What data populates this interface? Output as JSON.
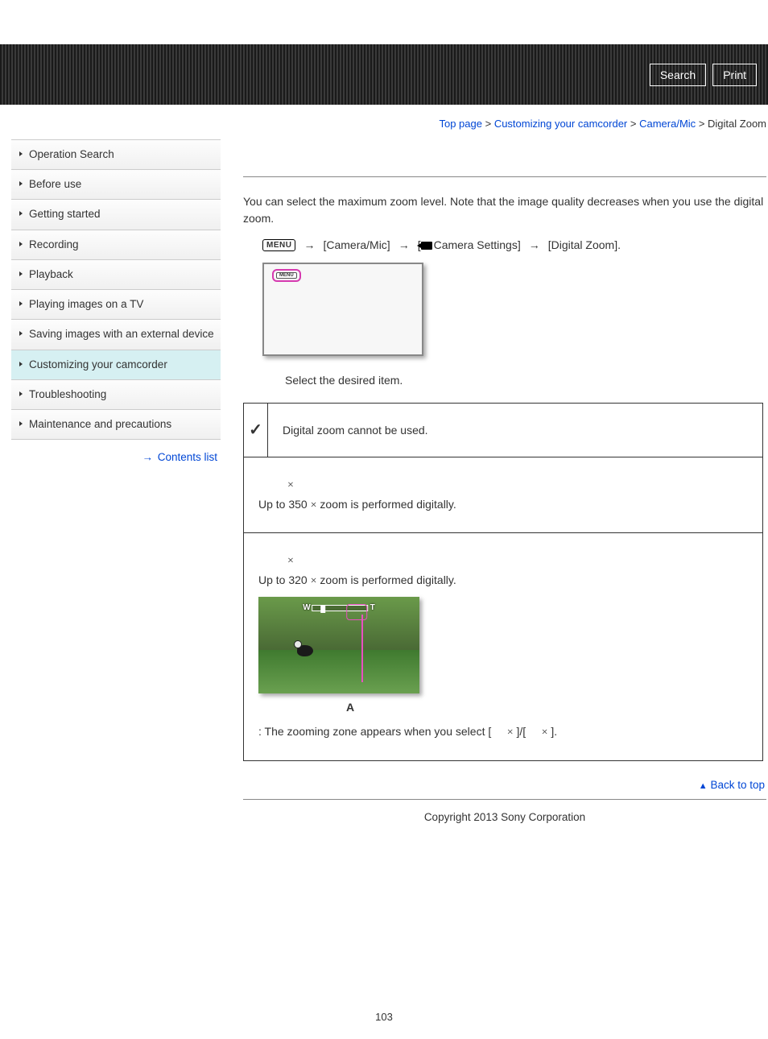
{
  "header": {
    "search": "Search",
    "print": "Print"
  },
  "breadcrumb": {
    "items": [
      "Top page",
      "Customizing your camcorder",
      "Camera/Mic",
      "Digital Zoom"
    ],
    "sep": ">"
  },
  "sidebar": {
    "items": [
      "Operation Search",
      "Before use",
      "Getting started",
      "Recording",
      "Playback",
      "Playing images on a TV",
      "Saving images with an external device",
      "Customizing your camcorder",
      "Troubleshooting",
      "Maintenance and precautions"
    ],
    "active_index": 7,
    "contents_link": "Contents list"
  },
  "content": {
    "intro": "You can select the maximum zoom level. Note that the image quality decreases when you use the digital zoom.",
    "menu_badge": "MENU",
    "path_seg1": "[Camera/Mic]",
    "path_seg2_pre": "[",
    "path_seg2_post": "Camera Settings]",
    "path_seg3": "[Digital Zoom].",
    "select_text": "Select the desired item.",
    "row1": "Digital zoom cannot be used.",
    "row2_l1_pre": "Up to 350 ",
    "row2_l1_post": " zoom is performed digitally.",
    "row3_l1_pre": "Up to 320 ",
    "row3_l1_post": " zoom is performed digitally.",
    "a_label": "A",
    "zoom_note_pre": ": The zooming zone appears when you select [",
    "zoom_note_mid": "]/[",
    "zoom_note_post": "].",
    "times": "×",
    "back_to_top": "Back to top",
    "copyright": "Copyright 2013 Sony Corporation",
    "page_num": "103",
    "zoom_w": "W",
    "zoom_t": "T"
  }
}
